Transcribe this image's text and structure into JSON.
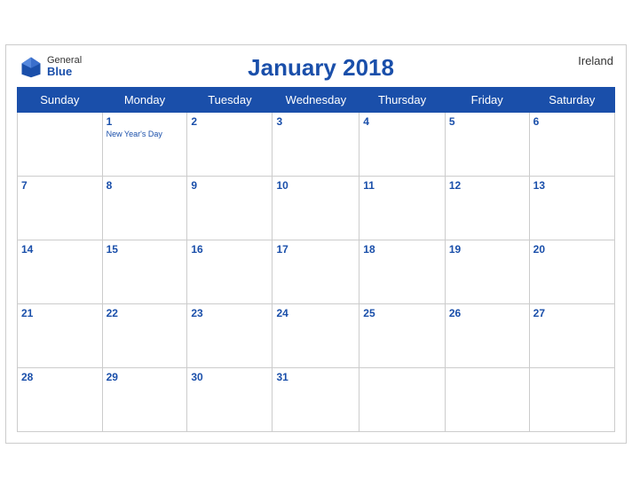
{
  "header": {
    "logo_general": "General",
    "logo_blue": "Blue",
    "title": "January 2018",
    "country": "Ireland"
  },
  "weekdays": [
    "Sunday",
    "Monday",
    "Tuesday",
    "Wednesday",
    "Thursday",
    "Friday",
    "Saturday"
  ],
  "weeks": [
    [
      {
        "day": "",
        "empty": true
      },
      {
        "day": "1",
        "holiday": "New Year's Day"
      },
      {
        "day": "2",
        "holiday": ""
      },
      {
        "day": "3",
        "holiday": ""
      },
      {
        "day": "4",
        "holiday": ""
      },
      {
        "day": "5",
        "holiday": ""
      },
      {
        "day": "6",
        "holiday": ""
      }
    ],
    [
      {
        "day": "7",
        "holiday": ""
      },
      {
        "day": "8",
        "holiday": ""
      },
      {
        "day": "9",
        "holiday": ""
      },
      {
        "day": "10",
        "holiday": ""
      },
      {
        "day": "11",
        "holiday": ""
      },
      {
        "day": "12",
        "holiday": ""
      },
      {
        "day": "13",
        "holiday": ""
      }
    ],
    [
      {
        "day": "14",
        "holiday": ""
      },
      {
        "day": "15",
        "holiday": ""
      },
      {
        "day": "16",
        "holiday": ""
      },
      {
        "day": "17",
        "holiday": ""
      },
      {
        "day": "18",
        "holiday": ""
      },
      {
        "day": "19",
        "holiday": ""
      },
      {
        "day": "20",
        "holiday": ""
      }
    ],
    [
      {
        "day": "21",
        "holiday": ""
      },
      {
        "day": "22",
        "holiday": ""
      },
      {
        "day": "23",
        "holiday": ""
      },
      {
        "day": "24",
        "holiday": ""
      },
      {
        "day": "25",
        "holiday": ""
      },
      {
        "day": "26",
        "holiday": ""
      },
      {
        "day": "27",
        "holiday": ""
      }
    ],
    [
      {
        "day": "28",
        "holiday": ""
      },
      {
        "day": "29",
        "holiday": ""
      },
      {
        "day": "30",
        "holiday": ""
      },
      {
        "day": "31",
        "holiday": ""
      },
      {
        "day": "",
        "empty": true
      },
      {
        "day": "",
        "empty": true
      },
      {
        "day": "",
        "empty": true
      }
    ]
  ],
  "colors": {
    "header_bg": "#1a4faa",
    "accent": "#1a4faa"
  }
}
